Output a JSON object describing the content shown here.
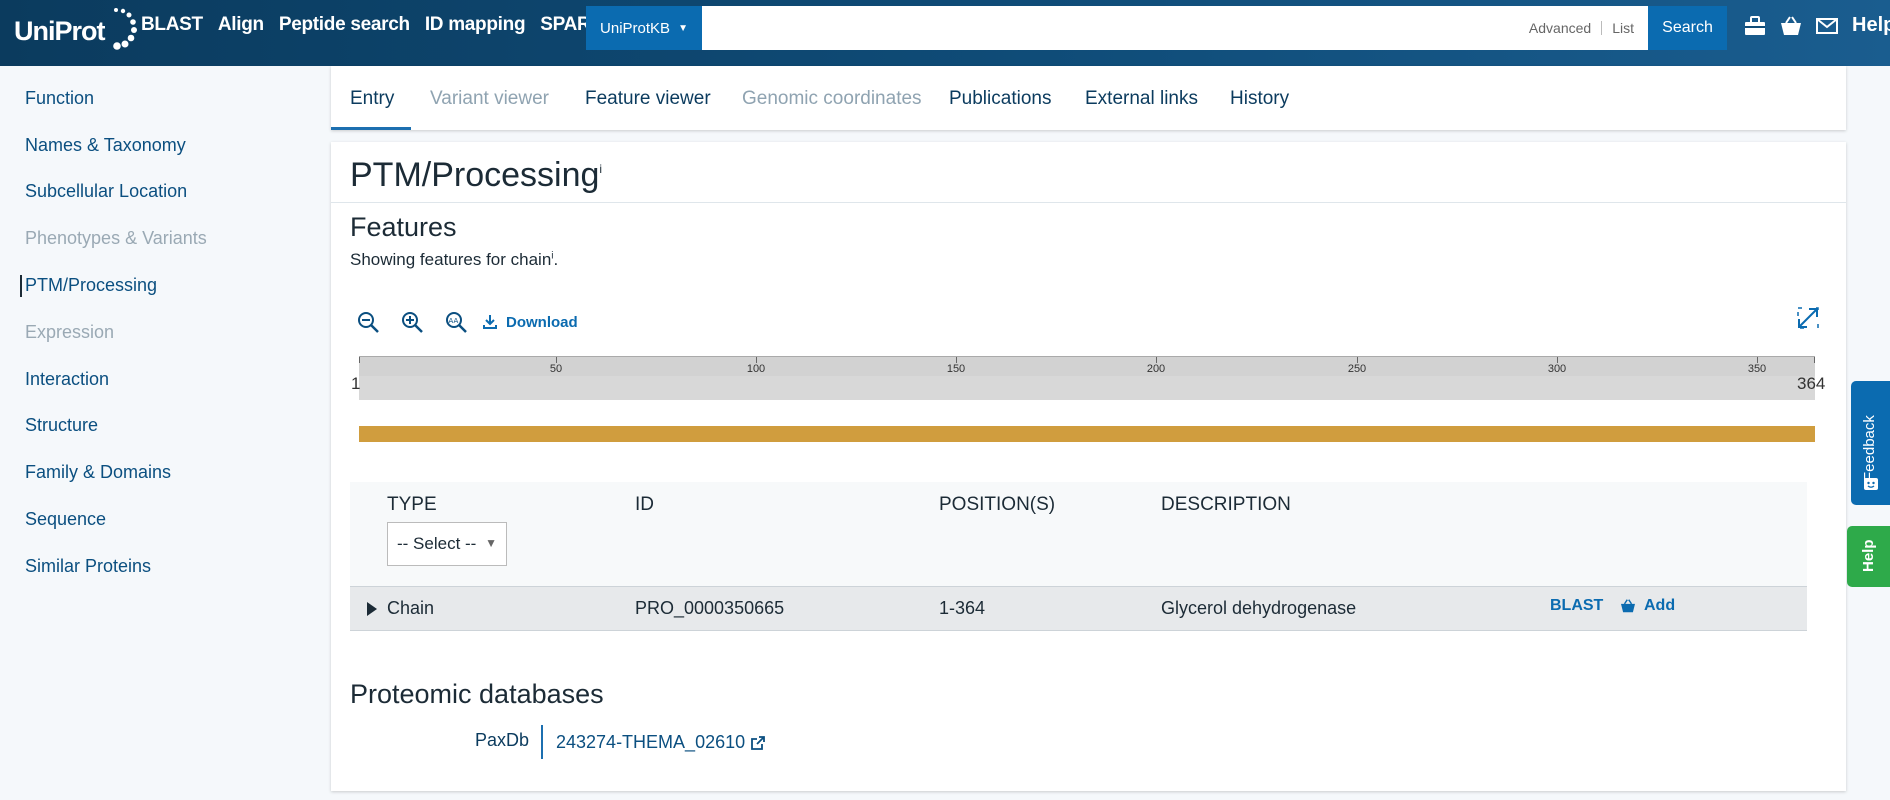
{
  "header": {
    "logo": "UniProt",
    "nav": [
      "BLAST",
      "Align",
      "Peptide search",
      "ID mapping",
      "SPARQL"
    ],
    "database": "UniProtKB",
    "search_value": "",
    "advanced": "Advanced",
    "list": "List",
    "search_button": "Search",
    "help": "Help",
    "icons": [
      "toolbox-icon",
      "basket-icon",
      "mail-icon"
    ]
  },
  "sidebar": {
    "items": [
      {
        "label": "Function",
        "state": "normal"
      },
      {
        "label": "Names & Taxonomy",
        "state": "normal"
      },
      {
        "label": "Subcellular Location",
        "state": "normal"
      },
      {
        "label": "Phenotypes & Variants",
        "state": "disabled"
      },
      {
        "label": "PTM/Processing",
        "state": "active"
      },
      {
        "label": "Expression",
        "state": "disabled"
      },
      {
        "label": "Interaction",
        "state": "normal"
      },
      {
        "label": "Structure",
        "state": "normal"
      },
      {
        "label": "Family & Domains",
        "state": "normal"
      },
      {
        "label": "Sequence",
        "state": "normal"
      },
      {
        "label": "Similar Proteins",
        "state": "normal"
      }
    ]
  },
  "tabs": [
    {
      "label": "Entry",
      "state": "active"
    },
    {
      "label": "Variant viewer",
      "state": "disabled"
    },
    {
      "label": "Feature viewer",
      "state": "normal"
    },
    {
      "label": "Genomic coordinates",
      "state": "disabled"
    },
    {
      "label": "Publications",
      "state": "normal"
    },
    {
      "label": "External links",
      "state": "normal"
    },
    {
      "label": "History",
      "state": "normal"
    }
  ],
  "section": {
    "title": "PTM/Processing",
    "info_marker": "i",
    "features_heading": "Features",
    "showing_text": "Showing features for chain",
    "showing_marker": "i",
    "showing_end": "."
  },
  "viewer": {
    "download": "Download",
    "ruler_start": "1",
    "ruler_end": "364",
    "ticks": [
      "50",
      "100",
      "150",
      "200",
      "250",
      "300",
      "350"
    ],
    "track_color": "#d09d3e"
  },
  "table": {
    "headers": {
      "type": "TYPE",
      "id": "ID",
      "positions": "POSITION(S)",
      "description": "DESCRIPTION"
    },
    "type_select": "-- Select --",
    "rows": [
      {
        "type": "Chain",
        "id": "PRO_0000350665",
        "positions": "1-364",
        "description": "Glycerol dehydrogenase",
        "blast": "BLAST",
        "add": "Add"
      }
    ]
  },
  "proteomic": {
    "heading": "Proteomic databases",
    "db_name": "PaxDb",
    "db_link": "243274-THEMA_02610"
  },
  "side_tabs": {
    "feedback": "Feedback",
    "help": "Help"
  }
}
